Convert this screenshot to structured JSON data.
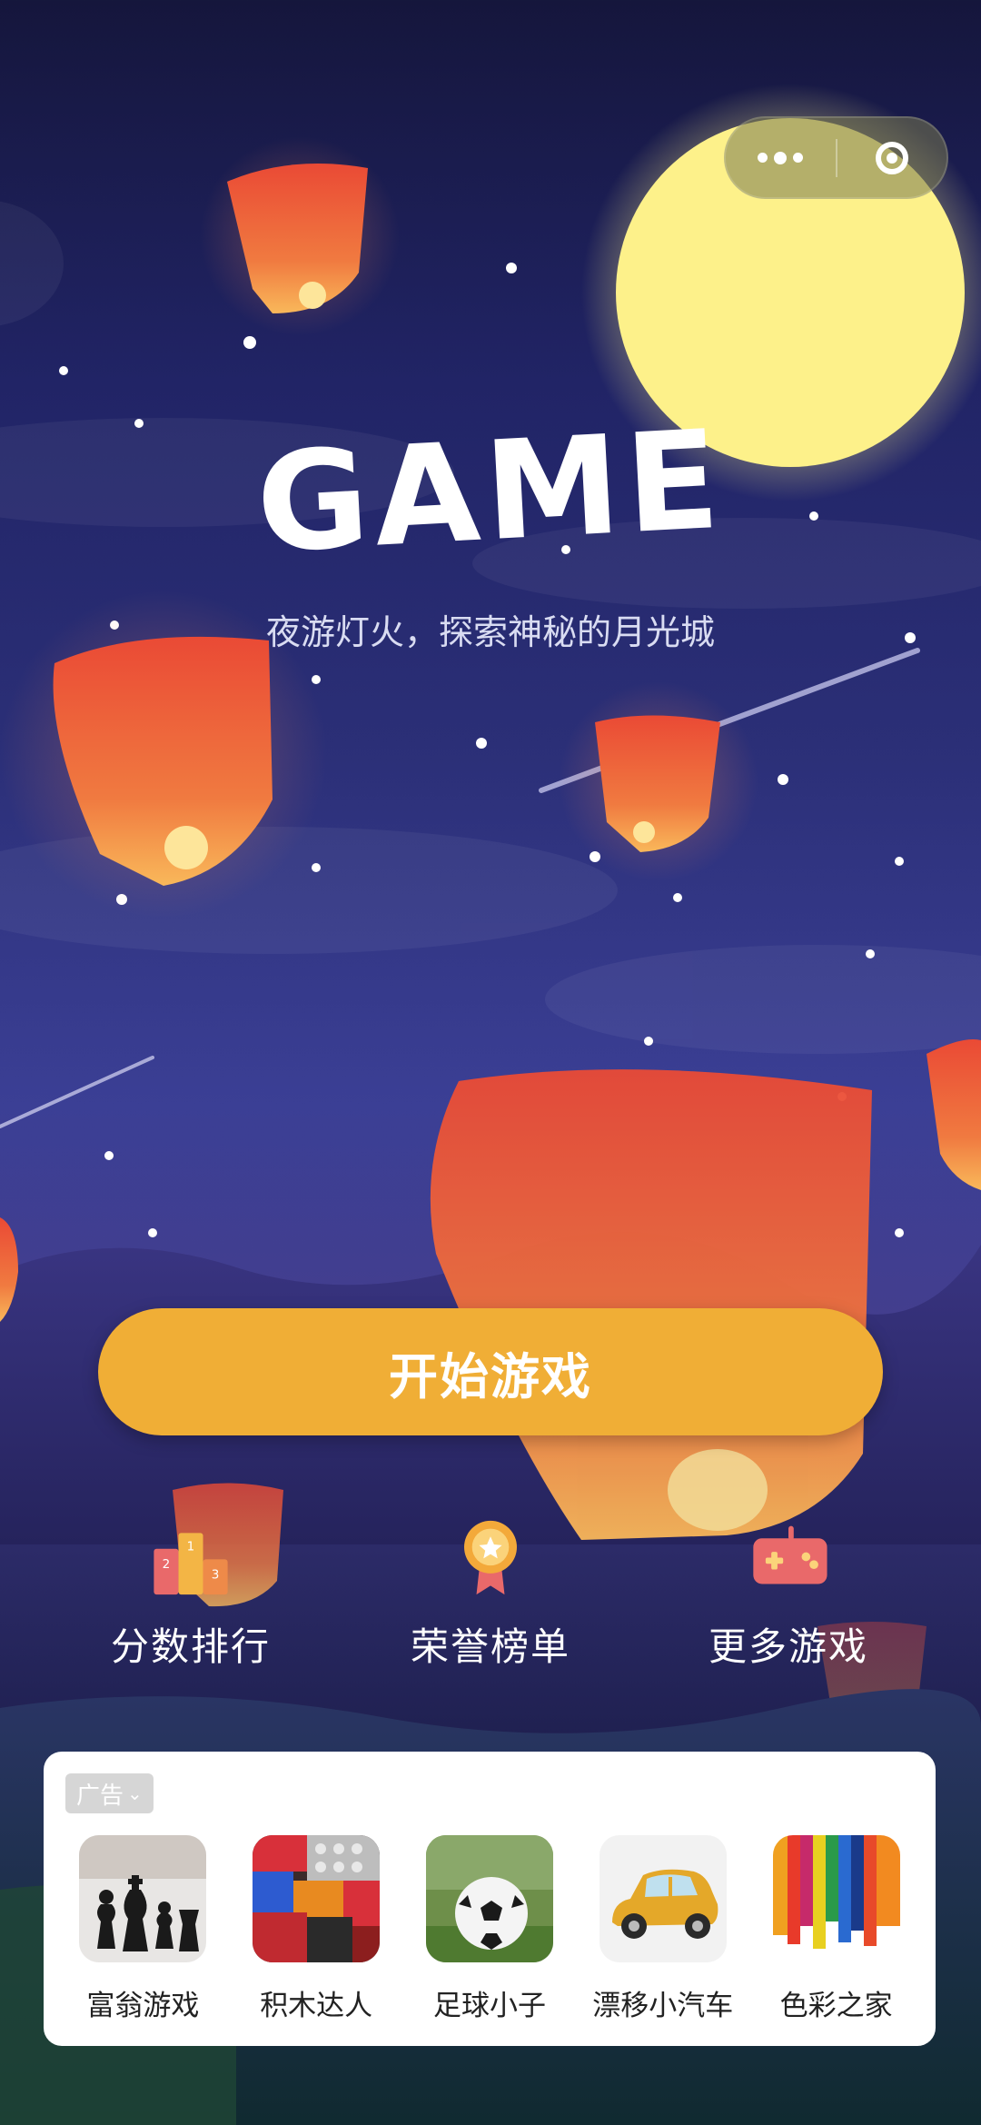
{
  "title": "GAME",
  "subtitle": "夜游灯火，探索神秘的月光城",
  "capsule": {
    "more_icon": "more-dots-icon",
    "close_icon": "target-close-icon"
  },
  "start_button": {
    "label": "开始游戏",
    "color": "#f0ae36"
  },
  "menu": [
    {
      "label": "分数排行",
      "icon": "podium-icon"
    },
    {
      "label": "荣誉榜单",
      "icon": "medal-icon"
    },
    {
      "label": "更多游戏",
      "icon": "gamepad-icon"
    }
  ],
  "ad": {
    "badge": "广告",
    "items": [
      {
        "name": "富翁游戏",
        "icon": "chess-icon"
      },
      {
        "name": "积木达人",
        "icon": "blocks-icon"
      },
      {
        "name": "足球小子",
        "icon": "soccer-ball-icon"
      },
      {
        "name": "漂移小汽车",
        "icon": "car-icon"
      },
      {
        "name": "色彩之家",
        "icon": "paint-icon"
      }
    ]
  },
  "colors": {
    "moon": "#fdf18a",
    "lantern": "#ef5a3a",
    "accent": "#f0ae36"
  }
}
